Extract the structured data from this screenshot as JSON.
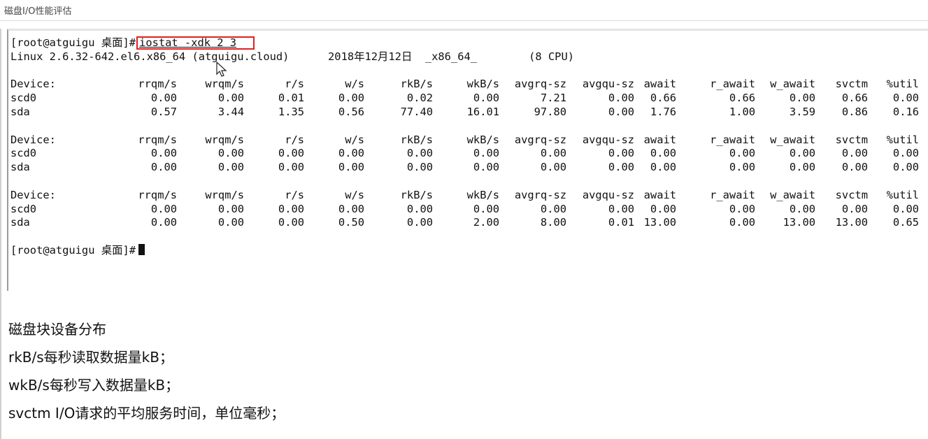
{
  "document": {
    "title": "磁盘I/O性能评估"
  },
  "terminal": {
    "prompt": "[root@atguigu 桌面]#",
    "command": "iostat -xdk 2 3",
    "system_info": "Linux 2.6.32-642.el6.x86_64 (atguigu.cloud)      2018年12月12日  _x86_64_        (8 CPU)",
    "columns": [
      "Device:",
      "rrqm/s",
      "wrqm/s",
      "r/s",
      "w/s",
      "rkB/s",
      "wkB/s",
      "avgrq-sz",
      "avgqu-sz",
      "await",
      "r_await",
      "w_await",
      "svctm",
      "%util"
    ],
    "reports": [
      {
        "rows": [
          {
            "device": "scd0",
            "values": [
              "0.00",
              "0.00",
              "0.01",
              "0.00",
              "0.02",
              "0.00",
              "7.21",
              "0.00",
              "0.66",
              "0.66",
              "0.00",
              "0.66",
              "0.00"
            ]
          },
          {
            "device": "sda",
            "values": [
              "0.57",
              "3.44",
              "1.35",
              "0.56",
              "77.40",
              "16.01",
              "97.80",
              "0.00",
              "1.76",
              "1.00",
              "3.59",
              "0.86",
              "0.16"
            ]
          }
        ]
      },
      {
        "rows": [
          {
            "device": "scd0",
            "values": [
              "0.00",
              "0.00",
              "0.00",
              "0.00",
              "0.00",
              "0.00",
              "0.00",
              "0.00",
              "0.00",
              "0.00",
              "0.00",
              "0.00",
              "0.00"
            ]
          },
          {
            "device": "sda",
            "values": [
              "0.00",
              "0.00",
              "0.00",
              "0.00",
              "0.00",
              "0.00",
              "0.00",
              "0.00",
              "0.00",
              "0.00",
              "0.00",
              "0.00",
              "0.00"
            ]
          }
        ]
      },
      {
        "rows": [
          {
            "device": "scd0",
            "values": [
              "0.00",
              "0.00",
              "0.00",
              "0.00",
              "0.00",
              "0.00",
              "0.00",
              "0.00",
              "0.00",
              "0.00",
              "0.00",
              "0.00",
              "0.00"
            ]
          },
          {
            "device": "sda",
            "values": [
              "0.00",
              "0.00",
              "0.00",
              "0.50",
              "0.00",
              "2.00",
              "8.00",
              "0.01",
              "13.00",
              "0.00",
              "13.00",
              "13.00",
              "0.65"
            ]
          }
        ]
      }
    ],
    "final_prompt": "[root@atguigu 桌面]#",
    "highlight_color": "#e02020"
  },
  "notes": [
    "磁盘块设备分布",
    "rkB/s每秒读取数据量kB；",
    "wkB/s每秒写入数据量kB；",
    "svctm I/O请求的平均服务时间，单位毫秒；"
  ],
  "icons": {
    "pointer": "mouse-pointer-icon",
    "cursor": "terminal-cursor-icon"
  }
}
